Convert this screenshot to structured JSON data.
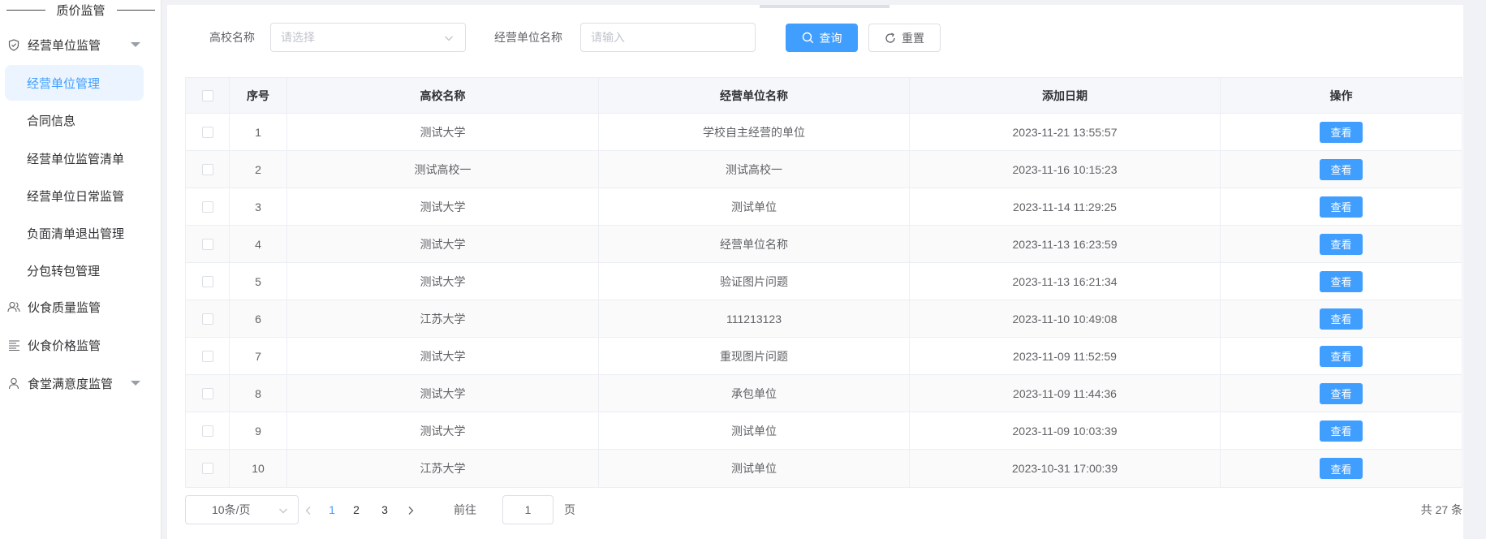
{
  "sidebar": {
    "header": "质价监管",
    "groups": [
      {
        "label": "经营单位监管",
        "icon": "shield-check-icon"
      },
      {
        "label": "伙食质量监管",
        "icon": "users-icon"
      },
      {
        "label": "伙食价格监管",
        "icon": "list-icon"
      },
      {
        "label": "食堂满意度监管",
        "icon": "user-icon"
      }
    ],
    "sub_items": [
      {
        "label": "经营单位管理",
        "active": true
      },
      {
        "label": "合同信息"
      },
      {
        "label": "经营单位监管清单"
      },
      {
        "label": "经营单位日常监管"
      },
      {
        "label": "负面清单退出管理"
      },
      {
        "label": "分包转包管理"
      }
    ]
  },
  "search": {
    "school_label": "高校名称",
    "school_placeholder": "请选择",
    "unit_label": "经营单位名称",
    "unit_placeholder": "请输入",
    "query_label": "查询",
    "reset_label": "重置"
  },
  "table": {
    "headers": [
      "序号",
      "高校名称",
      "经营单位名称",
      "添加日期",
      "操作"
    ],
    "action_label": "查看",
    "rows": [
      {
        "no": "1",
        "school": "测试大学",
        "unit": "学校自主经营的单位",
        "date": "2023-11-21 13:55:57"
      },
      {
        "no": "2",
        "school": "测试高校一",
        "unit": "测试高校一",
        "date": "2023-11-16 10:15:23"
      },
      {
        "no": "3",
        "school": "测试大学",
        "unit": "测试单位",
        "date": "2023-11-14 11:29:25"
      },
      {
        "no": "4",
        "school": "测试大学",
        "unit": "经营单位名称",
        "date": "2023-11-13 16:23:59"
      },
      {
        "no": "5",
        "school": "测试大学",
        "unit": "验证图片问题",
        "date": "2023-11-13 16:21:34"
      },
      {
        "no": "6",
        "school": "江苏大学",
        "unit": "111213123",
        "date": "2023-11-10 10:49:08"
      },
      {
        "no": "7",
        "school": "测试大学",
        "unit": "重现图片问题",
        "date": "2023-11-09 11:52:59"
      },
      {
        "no": "8",
        "school": "测试大学",
        "unit": "承包单位",
        "date": "2023-11-09 11:44:36"
      },
      {
        "no": "9",
        "school": "测试大学",
        "unit": "测试单位",
        "date": "2023-11-09 10:03:39"
      },
      {
        "no": "10",
        "school": "江苏大学",
        "unit": "测试单位",
        "date": "2023-10-31 17:00:39"
      }
    ]
  },
  "pagination": {
    "page_size": "10条/页",
    "pages": [
      "1",
      "2",
      "3"
    ],
    "current": "1",
    "goto_prefix": "前往",
    "goto_value": "1",
    "goto_suffix": "页",
    "total": "共 27 条"
  },
  "colors": {
    "primary": "#409eff",
    "active_bg": "#ecf5ff"
  }
}
